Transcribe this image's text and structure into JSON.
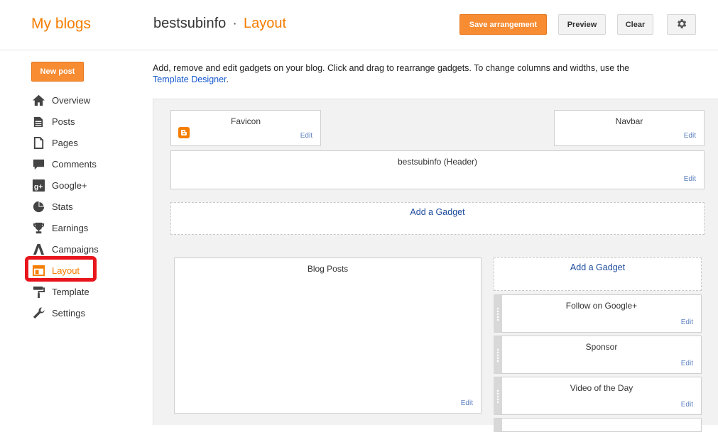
{
  "header": {
    "brand": "My blogs",
    "blog_name": "bestsubinfo",
    "separator": "·",
    "page_title": "Layout",
    "save_label": "Save arrangement",
    "preview_label": "Preview",
    "clear_label": "Clear",
    "settings_icon": "gear-icon"
  },
  "sidebar": {
    "new_post_label": "New post",
    "items": [
      {
        "label": "Overview",
        "icon": "home-icon"
      },
      {
        "label": "Posts",
        "icon": "posts-icon"
      },
      {
        "label": "Pages",
        "icon": "pages-icon"
      },
      {
        "label": "Comments",
        "icon": "comment-icon"
      },
      {
        "label": "Google+",
        "icon": "google-plus-icon"
      },
      {
        "label": "Stats",
        "icon": "pie-chart-icon"
      },
      {
        "label": "Earnings",
        "icon": "trophy-icon"
      },
      {
        "label": "Campaigns",
        "icon": "campaigns-icon"
      },
      {
        "label": "Layout",
        "icon": "layout-icon"
      },
      {
        "label": "Template",
        "icon": "paint-roller-icon"
      },
      {
        "label": "Settings",
        "icon": "wrench-icon"
      }
    ],
    "active": "Layout"
  },
  "main": {
    "description": "Add, remove and edit gadgets on your blog. Click and drag to rearrange gadgets. To change columns and widths, use the",
    "template_designer_link": "Template Designer",
    "link_suffix": ".",
    "edit_label": "Edit",
    "add_gadget_label": "Add a Gadget",
    "gadgets": {
      "favicon": "Favicon",
      "navbar": "Navbar",
      "header": "bestsubinfo (Header)",
      "blog_posts": "Blog Posts",
      "follow": "Follow on Google+",
      "sponsor": "Sponsor",
      "video": "Video of the Day"
    }
  },
  "colors": {
    "accent": "#f57d00",
    "button_orange": "#f78c33",
    "link_blue": "#1155cc",
    "highlight_red": "#e8151c"
  }
}
